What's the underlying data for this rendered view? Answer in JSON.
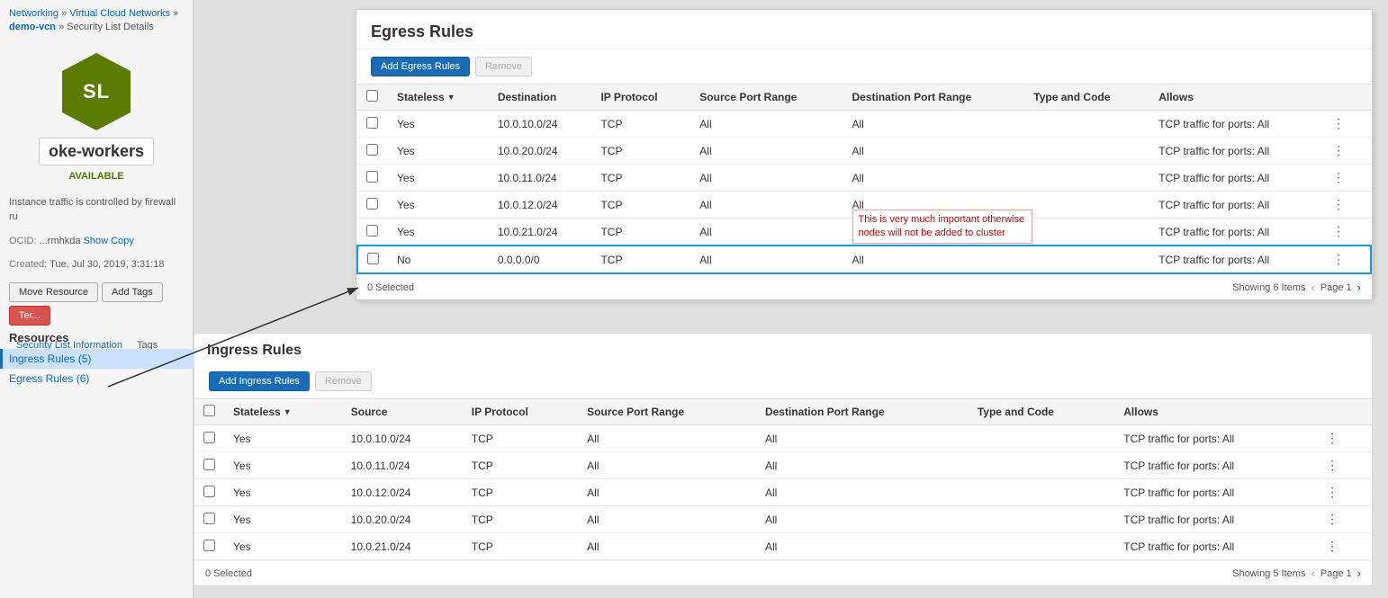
{
  "breadcrumb": {
    "networking": "Networking",
    "vcn": "Virtual Cloud Networks",
    "demo_vcn": "demo-vcn",
    "details": "Security List Details"
  },
  "resource": {
    "initials": "SL",
    "name": "oke-workers",
    "status": "AVAILABLE",
    "ocid_label": "OCID: ",
    "ocid_value": "...rmhkda",
    "show_link": "Show",
    "copy_link": "Copy",
    "created_label": "Created:",
    "created_value": "Tue, Jul 30, 2019, 3:31:18"
  },
  "description": "Instance traffic is controlled by firewall ru",
  "action_buttons": {
    "move": "Move Resource",
    "add_tags": "Add Tags",
    "terminate": "Ter..."
  },
  "tabs": {
    "info": "Security List Information",
    "tags": "Tags"
  },
  "resources_section": {
    "title": "Resources",
    "ingress_link": "Ingress Rules (5)",
    "egress_link": "Egress Rules (6)"
  },
  "egress_panel": {
    "title": "Egress Rules",
    "add_button": "Add Egress Rules",
    "remove_button": "Remove",
    "columns": {
      "stateless": "Stateless",
      "destination": "Destination",
      "ip_protocol": "IP Protocol",
      "source_port_range": "Source Port Range",
      "destination_port_range": "Destination Port Range",
      "type_and_code": "Type and Code",
      "allows": "Allows"
    },
    "rows": [
      {
        "stateless": "Yes",
        "destination": "10.0.10.0/24",
        "ip_protocol": "TCP",
        "source_port_range": "All",
        "destination_port_range": "All",
        "type_and_code": "",
        "allows": "TCP traffic for ports: All",
        "highlighted": false
      },
      {
        "stateless": "Yes",
        "destination": "10.0.20.0/24",
        "ip_protocol": "TCP",
        "source_port_range": "All",
        "destination_port_range": "All",
        "type_and_code": "",
        "allows": "TCP traffic for ports: All",
        "highlighted": false
      },
      {
        "stateless": "Yes",
        "destination": "10.0.11.0/24",
        "ip_protocol": "TCP",
        "source_port_range": "All",
        "destination_port_range": "All",
        "type_and_code": "",
        "allows": "TCP traffic for ports: All",
        "highlighted": false
      },
      {
        "stateless": "Yes",
        "destination": "10.0.12.0/24",
        "ip_protocol": "TCP",
        "source_port_range": "All",
        "destination_port_range": "All",
        "type_and_code": "",
        "allows": "TCP traffic for ports: All",
        "highlighted": false
      },
      {
        "stateless": "Yes",
        "destination": "10.0.21.0/24",
        "ip_protocol": "TCP",
        "source_port_range": "All",
        "destination_port_range": "All",
        "type_and_code": "",
        "allows": "TCP traffic for ports: All",
        "highlighted": false
      },
      {
        "stateless": "No",
        "destination": "0.0.0.0/0",
        "ip_protocol": "TCP",
        "source_port_range": "All",
        "destination_port_range": "All",
        "type_and_code": "",
        "allows": "TCP traffic for ports: All",
        "highlighted": true
      }
    ],
    "annotation": "This is very much important otherwise nodes will not be added to cluster",
    "footer": {
      "selected": "0 Selected",
      "showing": "Showing 6 Items",
      "page": "Page 1"
    }
  },
  "ingress_section": {
    "title": "Ingress Rules",
    "add_button": "Add Ingress Rules",
    "remove_button": "Remove",
    "columns": {
      "stateless": "Stateless",
      "source": "Source",
      "ip_protocol": "IP Protocol",
      "source_port_range": "Source Port Range",
      "destination_port_range": "Destination Port Range",
      "type_and_code": "Type and Code",
      "allows": "Allows"
    },
    "rows": [
      {
        "stateless": "Yes",
        "source": "10.0.10.0/24",
        "ip_protocol": "TCP",
        "source_port_range": "All",
        "destination_port_range": "All",
        "type_and_code": "",
        "allows": "TCP traffic for ports: All"
      },
      {
        "stateless": "Yes",
        "source": "10.0.11.0/24",
        "ip_protocol": "TCP",
        "source_port_range": "All",
        "destination_port_range": "All",
        "type_and_code": "",
        "allows": "TCP traffic for ports: All"
      },
      {
        "stateless": "Yes",
        "source": "10.0.12.0/24",
        "ip_protocol": "TCP",
        "source_port_range": "All",
        "destination_port_range": "All",
        "type_and_code": "",
        "allows": "TCP traffic for ports: All"
      },
      {
        "stateless": "Yes",
        "source": "10.0.20.0/24",
        "ip_protocol": "TCP",
        "source_port_range": "All",
        "destination_port_range": "All",
        "type_and_code": "",
        "allows": "TCP traffic for ports: All"
      },
      {
        "stateless": "Yes",
        "source": "10.0.21.0/24",
        "ip_protocol": "TCP",
        "source_port_range": "All",
        "destination_port_range": "All",
        "type_and_code": "",
        "allows": "TCP traffic for ports: All"
      }
    ],
    "footer": {
      "selected": "0 Selected",
      "showing": "Showing 5 Items",
      "page": "Page 1"
    }
  }
}
